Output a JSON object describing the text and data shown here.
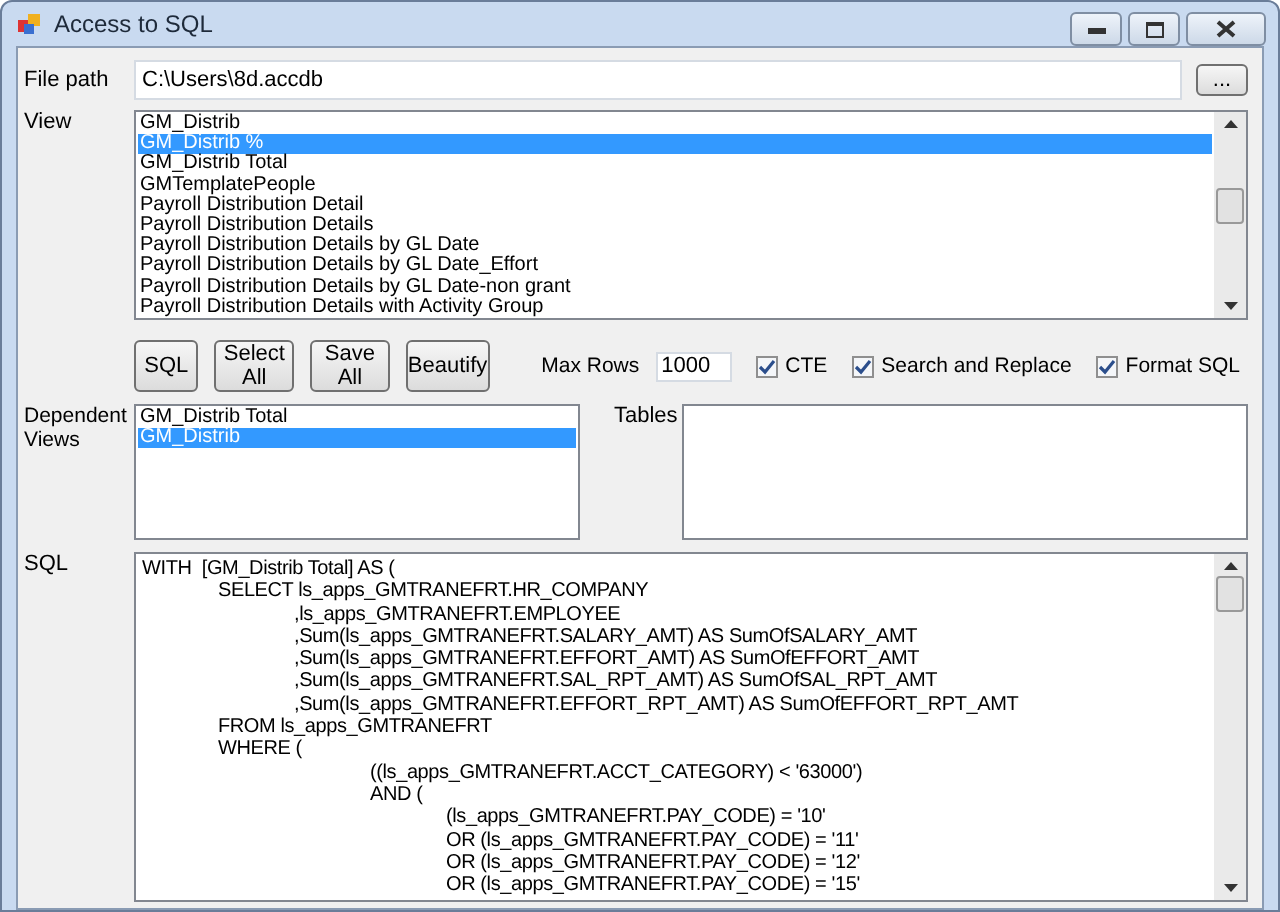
{
  "window": {
    "title": "Access to SQL"
  },
  "file_path": {
    "label": "File path",
    "value": "C:\\Users\\8d.accdb",
    "browse_button": "..."
  },
  "view": {
    "label": "View",
    "items": [
      {
        "text": "GM_Distrib",
        "selected": false
      },
      {
        "text": "GM_Distrib %",
        "selected": true
      },
      {
        "text": "GM_Distrib Total",
        "selected": false
      },
      {
        "text": "GMTemplatePeople",
        "selected": false
      },
      {
        "text": "Payroll Distribution Detail",
        "selected": false
      },
      {
        "text": "Payroll Distribution Details",
        "selected": false
      },
      {
        "text": "Payroll Distribution Details by GL Date",
        "selected": false
      },
      {
        "text": "Payroll Distribution Details by GL Date_Effort",
        "selected": false
      },
      {
        "text": "Payroll Distribution Details by GL Date-non grant",
        "selected": false
      },
      {
        "text": "Payroll Distribution Details with Activity Group",
        "selected": false
      }
    ]
  },
  "buttons": [
    "SQL",
    "Select All",
    "Save All",
    "Beautify"
  ],
  "max_rows": {
    "label": "Max Rows",
    "value": "1000"
  },
  "options": [
    {
      "label": "CTE",
      "checked": true
    },
    {
      "label": "Search and Replace",
      "checked": true
    },
    {
      "label": "Format SQL",
      "checked": true
    }
  ],
  "dependent_views": {
    "label": "Dependent Views",
    "items": [
      {
        "text": "GM_Distrib Total",
        "selected": false
      },
      {
        "text": "GM_Distrib",
        "selected": true
      }
    ]
  },
  "tables": {
    "label": "Tables"
  },
  "sql": {
    "label": "SQL",
    "lines": [
      "WITH  [GM_Distrib Total] AS (",
      "\tSELECT ls_apps_GMTRANEFRT.HR_COMPANY",
      "\t\t,ls_apps_GMTRANEFRT.EMPLOYEE",
      "\t\t,Sum(ls_apps_GMTRANEFRT.SALARY_AMT) AS SumOfSALARY_AMT",
      "\t\t,Sum(ls_apps_GMTRANEFRT.EFFORT_AMT) AS SumOfEFFORT_AMT",
      "\t\t,Sum(ls_apps_GMTRANEFRT.SAL_RPT_AMT) AS SumOfSAL_RPT_AMT",
      "\t\t,Sum(ls_apps_GMTRANEFRT.EFFORT_RPT_AMT) AS SumOfEFFORT_RPT_AMT",
      "\tFROM ls_apps_GMTRANEFRT",
      "\tWHERE (",
      "\t\t\t((ls_apps_GMTRANEFRT.ACCT_CATEGORY) < '63000')",
      "\t\t\tAND (",
      "\t\t\t\t(ls_apps_GMTRANEFRT.PAY_CODE) = '10'",
      "\t\t\t\tOR (ls_apps_GMTRANEFRT.PAY_CODE) = '11'",
      "\t\t\t\tOR (ls_apps_GMTRANEFRT.PAY_CODE) = '12'",
      "\t\t\t\tOR (ls_apps_GMTRANEFRT.PAY_CODE) = '15'"
    ]
  }
}
